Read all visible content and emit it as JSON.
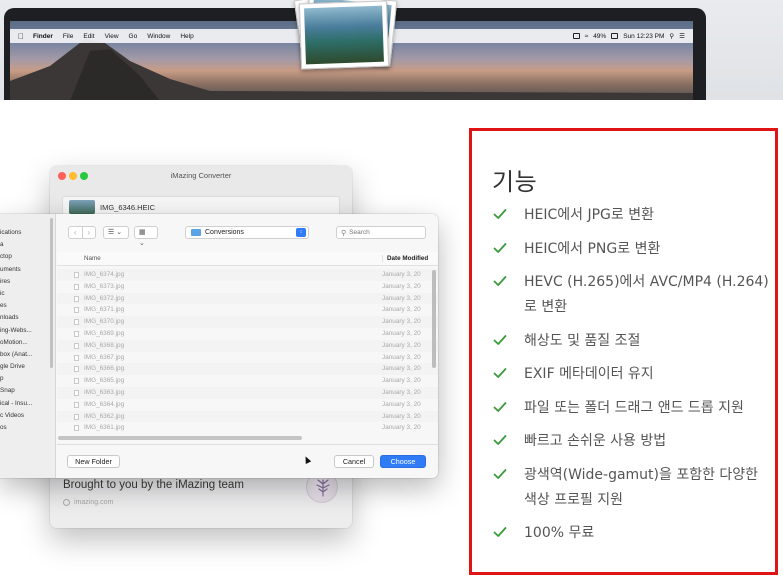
{
  "menubar": {
    "apple": "",
    "items": [
      "Finder",
      "File",
      "Edit",
      "View",
      "Go",
      "Window",
      "Help"
    ],
    "battery": "49%",
    "clock": "Sun 12:23 PM"
  },
  "converter": {
    "window_title": "iMazing Converter",
    "file_name": "IMG_6346.HEIC",
    "brought": "Brought to you by the iMazing team",
    "link": "imazing.com"
  },
  "dialog": {
    "sidebar": [
      "ications",
      "a",
      "ctop",
      "uments",
      "ires",
      "ic",
      "es",
      "nloads",
      "ing-Webs...",
      "oMotion...",
      "box (Anat...",
      "gle Drive",
      "p",
      "Snap",
      "ical - Insu...",
      "c Videos",
      "os"
    ],
    "nav_back": "‹",
    "nav_forward": "›",
    "view_list": "☰ ⌄",
    "view_grid": "▦ ⌄",
    "path_label": "Conversions",
    "search_placeholder": "Search",
    "col_name": "Name",
    "col_date": "Date Modified",
    "files": [
      {
        "name": "IMG_6374.jpg",
        "date": "January 3, 20"
      },
      {
        "name": "IMG_6373.jpg",
        "date": "January 3, 20"
      },
      {
        "name": "IMG_6372.jpg",
        "date": "January 3, 20"
      },
      {
        "name": "IMG_6371.jpg",
        "date": "January 3, 20"
      },
      {
        "name": "IMG_6370.jpg",
        "date": "January 3, 20"
      },
      {
        "name": "IMG_6369.jpg",
        "date": "January 3, 20"
      },
      {
        "name": "IMG_6368.jpg",
        "date": "January 3, 20"
      },
      {
        "name": "IMG_6367.jpg",
        "date": "January 3, 20"
      },
      {
        "name": "IMG_6366.jpg",
        "date": "January 3, 20"
      },
      {
        "name": "IMG_6365.jpg",
        "date": "January 3, 20"
      },
      {
        "name": "IMG_6363.jpg",
        "date": "January 3, 20"
      },
      {
        "name": "IMG_6364.jpg",
        "date": "January 3, 20"
      },
      {
        "name": "IMG_6362.jpg",
        "date": "January 3, 20"
      },
      {
        "name": "IMG_6361.jpg",
        "date": "January 3, 20"
      }
    ],
    "new_folder": "New Folder",
    "cancel": "Cancel",
    "choose": "Choose"
  },
  "features": {
    "title": "기능",
    "check_color": "#3a9a3c",
    "border_color": "#e01414",
    "items": [
      "HEIC에서 JPG로 변환",
      "HEIC에서 PNG로 변환",
      "HEVC (H.265)에서 AVC/MP4 (H.264)\n로 변환",
      "해상도 및 품질 조절",
      "EXIF 메타데이터 유지",
      "파일 또는 폴더 드래그 앤드 드롭 지원",
      "빠르고 손쉬운 사용 방법",
      "광색역(Wide-gamut)을 포함한 다양한\n색상 프로필 지원",
      "100% 무료"
    ]
  }
}
